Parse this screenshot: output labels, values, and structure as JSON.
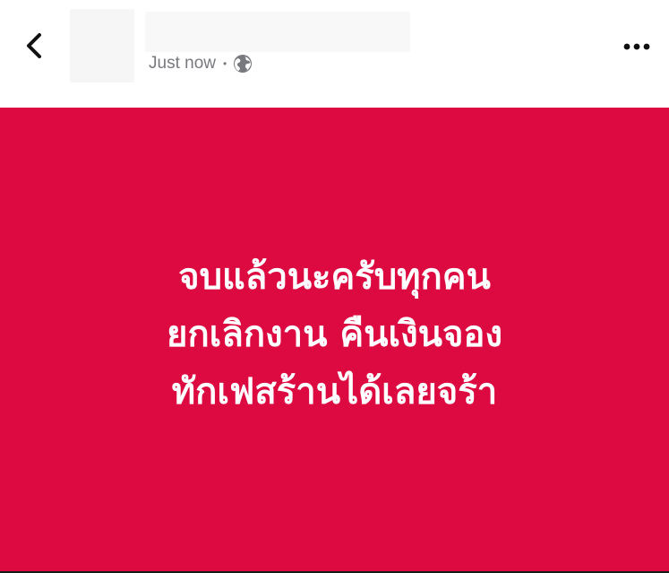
{
  "header": {
    "timestamp": "Just now",
    "separator": "•",
    "audience_icon": "globe-icon",
    "back_icon": "chevron-left-icon",
    "more_icon": "more-horizontal-icon"
  },
  "post": {
    "background_color": "#dc0a41",
    "text_color": "#ffffff",
    "lines": [
      "จบแล้วนะครับทุกคน",
      "ยกเลิกงาน คืนเงินจอง",
      "ทักเฟสร้านได้เลยจร้า"
    ]
  }
}
